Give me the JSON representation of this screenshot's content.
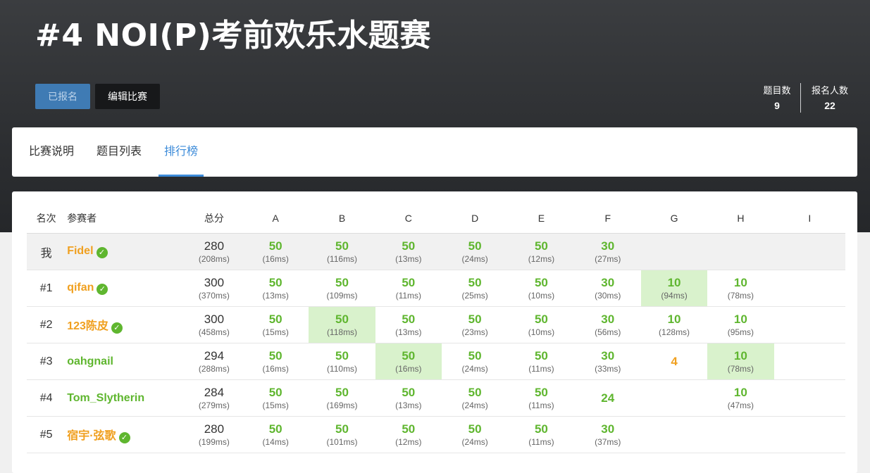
{
  "contest": {
    "title": "#4 NOI(P)考前欢乐水题赛",
    "joined_label": "已报名",
    "edit_label": "编辑比赛",
    "problems_label": "题目数",
    "problems_count": "9",
    "participants_label": "报名人数",
    "participants_count": "22"
  },
  "tabs": [
    "比赛说明",
    "题目列表",
    "排行榜"
  ],
  "ranking": {
    "headers": {
      "rank": "名次",
      "name": "参赛者",
      "total": "总分",
      "problems": [
        "A",
        "B",
        "C",
        "D",
        "E",
        "F",
        "G",
        "H",
        "I"
      ]
    },
    "rows": [
      {
        "rank": "我",
        "name": "Fidel",
        "name_color": "orange",
        "verified": true,
        "total": "280",
        "total_time": "(208ms)",
        "cells": [
          {
            "score": "50",
            "time": "(16ms)",
            "color": "green",
            "first": false
          },
          {
            "score": "50",
            "time": "(116ms)",
            "color": "green",
            "first": false
          },
          {
            "score": "50",
            "time": "(13ms)",
            "color": "green",
            "first": false
          },
          {
            "score": "50",
            "time": "(24ms)",
            "color": "green",
            "first": false
          },
          {
            "score": "50",
            "time": "(12ms)",
            "color": "green",
            "first": false
          },
          {
            "score": "30",
            "time": "(27ms)",
            "color": "green",
            "first": false
          },
          {
            "score": "",
            "time": "",
            "color": "green",
            "first": false
          },
          {
            "score": "",
            "time": "",
            "color": "green",
            "first": false
          },
          {
            "score": "",
            "time": "",
            "color": "green",
            "first": false
          }
        ]
      },
      {
        "rank": "#1",
        "name": "qifan",
        "name_color": "orange",
        "verified": true,
        "total": "300",
        "total_time": "(370ms)",
        "cells": [
          {
            "score": "50",
            "time": "(13ms)",
            "color": "green",
            "first": false
          },
          {
            "score": "50",
            "time": "(109ms)",
            "color": "green",
            "first": false
          },
          {
            "score": "50",
            "time": "(11ms)",
            "color": "green",
            "first": false
          },
          {
            "score": "50",
            "time": "(25ms)",
            "color": "green",
            "first": false
          },
          {
            "score": "50",
            "time": "(10ms)",
            "color": "green",
            "first": false
          },
          {
            "score": "30",
            "time": "(30ms)",
            "color": "green",
            "first": false
          },
          {
            "score": "10",
            "time": "(94ms)",
            "color": "green",
            "first": true
          },
          {
            "score": "10",
            "time": "(78ms)",
            "color": "green",
            "first": false
          },
          {
            "score": "",
            "time": "",
            "color": "green",
            "first": false
          }
        ]
      },
      {
        "rank": "#2",
        "name": "123陈皮",
        "name_color": "orange",
        "verified": true,
        "total": "300",
        "total_time": "(458ms)",
        "cells": [
          {
            "score": "50",
            "time": "(15ms)",
            "color": "green",
            "first": false
          },
          {
            "score": "50",
            "time": "(118ms)",
            "color": "green",
            "first": true
          },
          {
            "score": "50",
            "time": "(13ms)",
            "color": "green",
            "first": false
          },
          {
            "score": "50",
            "time": "(23ms)",
            "color": "green",
            "first": false
          },
          {
            "score": "50",
            "time": "(10ms)",
            "color": "green",
            "first": false
          },
          {
            "score": "30",
            "time": "(56ms)",
            "color": "green",
            "first": false
          },
          {
            "score": "10",
            "time": "(128ms)",
            "color": "green",
            "first": false
          },
          {
            "score": "10",
            "time": "(95ms)",
            "color": "green",
            "first": false
          },
          {
            "score": "",
            "time": "",
            "color": "green",
            "first": false
          }
        ]
      },
      {
        "rank": "#3",
        "name": "oahgnail",
        "name_color": "green",
        "verified": false,
        "total": "294",
        "total_time": "(288ms)",
        "cells": [
          {
            "score": "50",
            "time": "(16ms)",
            "color": "green",
            "first": false
          },
          {
            "score": "50",
            "time": "(110ms)",
            "color": "green",
            "first": false
          },
          {
            "score": "50",
            "time": "(16ms)",
            "color": "green",
            "first": true
          },
          {
            "score": "50",
            "time": "(24ms)",
            "color": "green",
            "first": false
          },
          {
            "score": "50",
            "time": "(11ms)",
            "color": "green",
            "first": false
          },
          {
            "score": "30",
            "time": "(33ms)",
            "color": "green",
            "first": false
          },
          {
            "score": "4",
            "time": "",
            "color": "orange",
            "first": false
          },
          {
            "score": "10",
            "time": "(78ms)",
            "color": "green",
            "first": true
          },
          {
            "score": "",
            "time": "",
            "color": "green",
            "first": false
          }
        ]
      },
      {
        "rank": "#4",
        "name": "Tom_Slytherin",
        "name_color": "green",
        "verified": false,
        "total": "284",
        "total_time": "(279ms)",
        "cells": [
          {
            "score": "50",
            "time": "(15ms)",
            "color": "green",
            "first": false
          },
          {
            "score": "50",
            "time": "(169ms)",
            "color": "green",
            "first": false
          },
          {
            "score": "50",
            "time": "(13ms)",
            "color": "green",
            "first": false
          },
          {
            "score": "50",
            "time": "(24ms)",
            "color": "green",
            "first": false
          },
          {
            "score": "50",
            "time": "(11ms)",
            "color": "green",
            "first": false
          },
          {
            "score": "24",
            "time": "",
            "color": "green",
            "first": false
          },
          {
            "score": "",
            "time": "",
            "color": "green",
            "first": false
          },
          {
            "score": "10",
            "time": "(47ms)",
            "color": "green",
            "first": false
          },
          {
            "score": "",
            "time": "",
            "color": "green",
            "first": false
          }
        ]
      },
      {
        "rank": "#5",
        "name": "宿宇·弦歌",
        "name_color": "orange",
        "verified": true,
        "total": "280",
        "total_time": "(199ms)",
        "cells": [
          {
            "score": "50",
            "time": "(14ms)",
            "color": "green",
            "first": false
          },
          {
            "score": "50",
            "time": "(101ms)",
            "color": "green",
            "first": false
          },
          {
            "score": "50",
            "time": "(12ms)",
            "color": "green",
            "first": false
          },
          {
            "score": "50",
            "time": "(24ms)",
            "color": "green",
            "first": false
          },
          {
            "score": "50",
            "time": "(11ms)",
            "color": "green",
            "first": false
          },
          {
            "score": "30",
            "time": "(37ms)",
            "color": "green",
            "first": false
          },
          {
            "score": "",
            "time": "",
            "color": "green",
            "first": false
          },
          {
            "score": "",
            "time": "",
            "color": "green",
            "first": false
          },
          {
            "score": "",
            "time": "",
            "color": "green",
            "first": false
          }
        ]
      }
    ]
  },
  "colors": {
    "accent_blue": "#3c8bd9",
    "score_green": "#5fb62f",
    "name_orange": "#f0a020",
    "first_solve_bg": "#d9f2cc"
  }
}
